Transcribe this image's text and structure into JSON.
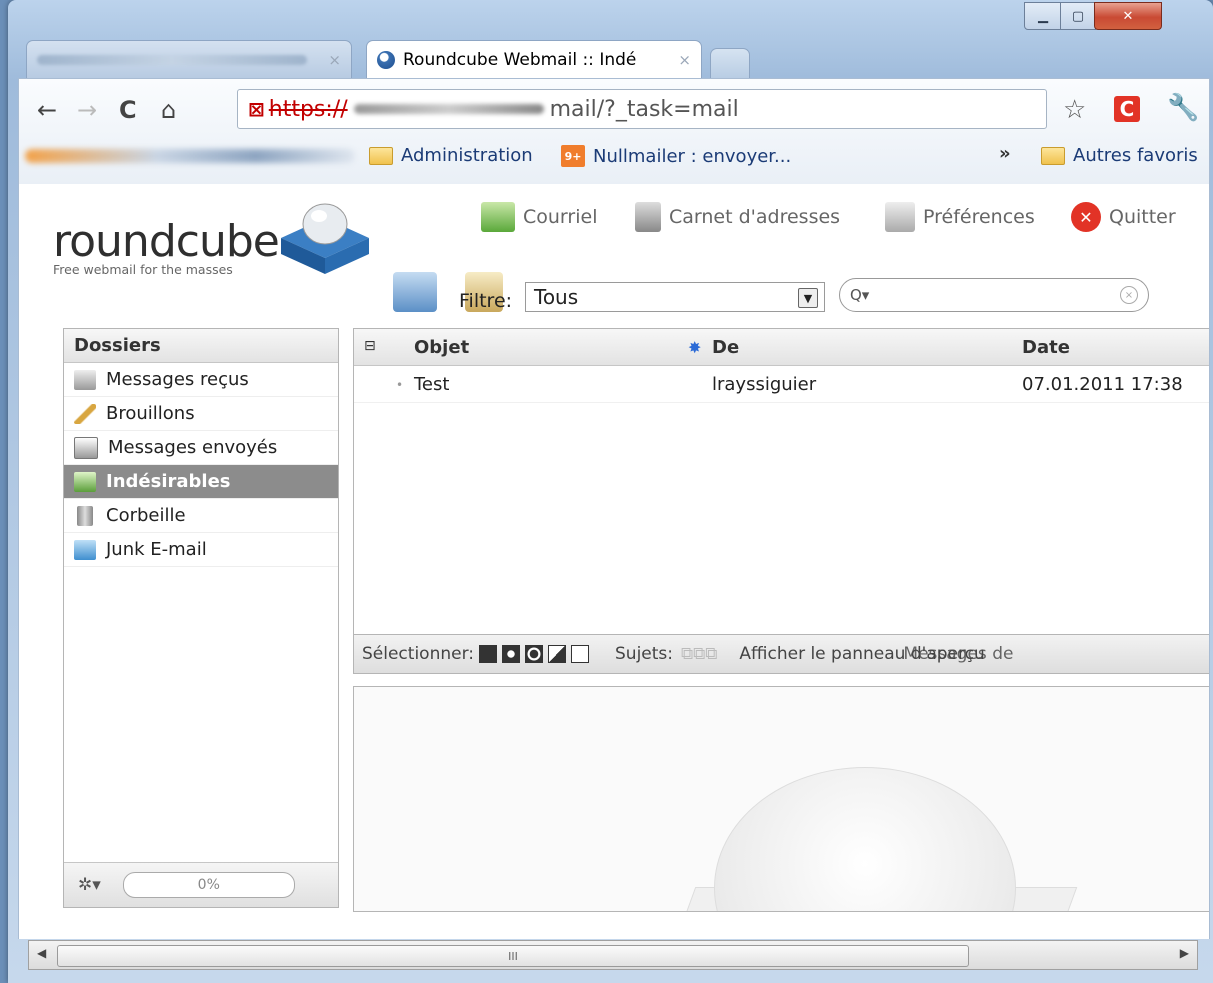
{
  "browser": {
    "tab_active_title": "Roundcube Webmail :: Indé",
    "tab_close": "×",
    "address_prefix": "https://",
    "address_path": "mail/?_task=mail",
    "bookmarks": [
      "Administration",
      "Nullmailer : envoyer..."
    ],
    "bookmarks_more": "»",
    "other_bookmarks": "Autres favoris"
  },
  "app": {
    "logo": "roundcube",
    "tagline": "Free webmail for the masses",
    "nav": [
      "Courriel",
      "Carnet d'adresses",
      "Préférences",
      "Quitter"
    ],
    "filter_label": "Filtre:",
    "filter_value": "Tous",
    "search_prefix": "Q▾",
    "search_value": ""
  },
  "folders": {
    "title": "Dossiers",
    "items": [
      "Messages reçus",
      "Brouillons",
      "Messages envoyés",
      "Indésirables",
      "Corbeille",
      "Junk E-mail"
    ],
    "selected_index": 3,
    "quota": "0%"
  },
  "list": {
    "columns": [
      "Objet",
      "De",
      "Date"
    ],
    "rows": [
      {
        "subject": "Test",
        "from": "lrayssiguier",
        "date": "07.01.2011 17:38"
      }
    ],
    "footer_select": "Sélectionner:",
    "footer_threads": "Sujets:",
    "footer_preview": "Afficher le panneau d'aperçu",
    "footer_overlap": "Messages de"
  },
  "scrollbar": {
    "grip": "III"
  },
  "colors": {
    "selected_folder": "#8c8c8c",
    "quit_red": "#e23326",
    "link_blue": "#1b3b76"
  }
}
